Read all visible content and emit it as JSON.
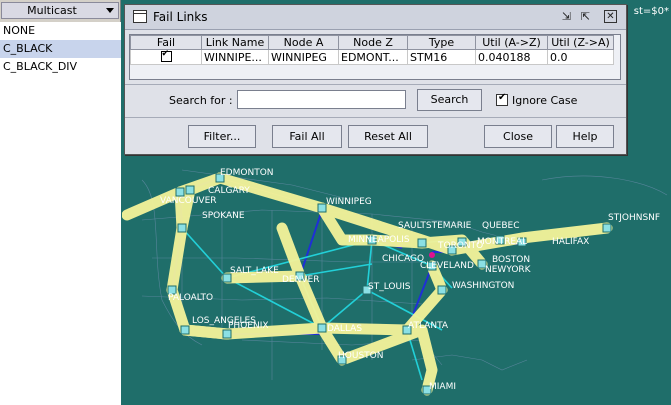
{
  "left_panel": {
    "combo_value": "Multicast",
    "items": [
      "NONE",
      "C_BLACK",
      "C_BLACK_DIV"
    ],
    "selected_index": 1
  },
  "map_corner_text": "st=$0*",
  "dialog": {
    "title": "Fail Links",
    "columns": [
      "Fail",
      "Link Name",
      "Node A",
      "Node Z",
      "Type",
      "Util (A->Z)",
      "Util (Z->A)"
    ],
    "rows": [
      {
        "fail": true,
        "link_name": "WINNIPE...",
        "node_a": "WINNIPEG",
        "node_z": "EDMONT...",
        "type": "STM16",
        "util_az": "0.040188",
        "util_za": "0.0"
      }
    ],
    "search_label": "Search for :",
    "search_value": "",
    "search_button": "Search",
    "ignore_case_label": "Ignore Case",
    "ignore_case_checked": true,
    "filter_button": "Filter...",
    "fail_all_button": "Fail All",
    "reset_all_button": "Reset All",
    "close_button": "Close",
    "help_button": "Help"
  },
  "map": {
    "cities": [
      "EDMONTON",
      "CALGARY",
      "VANCOUVER",
      "SPOKANE",
      "WINNIPEG",
      "SAULTSTEMARIE",
      "QUEBEC",
      "STJOHNSNF",
      "MINNEAPOLIS",
      "MONTREAL",
      "HALIFAX",
      "BOSTON",
      "NEWYORK",
      "CHICAGO",
      "CLEVELAND",
      "TORONTO",
      "WASHINGTON",
      "ST_LOUIS",
      "SALT_LAKE",
      "DENVER",
      "PALOALTO",
      "LOS_ANGELES",
      "PHOENIX",
      "DALLAS",
      "ATLANTA",
      "HOUSTON",
      "MIAMI"
    ]
  }
}
